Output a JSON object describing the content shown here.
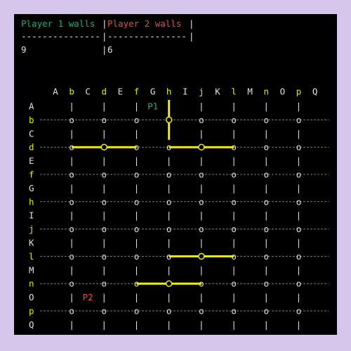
{
  "colors": {
    "background": "#d6c6ec",
    "terminal": "#000000",
    "text": "#e0e0e0",
    "gray_line": "#7a7a7a",
    "player1": "#12b07a",
    "player2": "#e0503c",
    "highlight": "#e8e600",
    "wall": "#f0f000"
  },
  "header": {
    "p1_label": "Player 1 walls",
    "sep1": "|",
    "p2_label": "Player 2 walls",
    "sep2": "|",
    "dashes_left": "---------------",
    "dashes_mid": "|",
    "dashes_right": "---------------",
    "dashes_end": "|",
    "p1_count": "9",
    "count_sep": "|",
    "p2_count": "6"
  },
  "board": {
    "col_labels": [
      "A",
      "b",
      "C",
      "d",
      "E",
      "f",
      "G",
      "h",
      "I",
      "j",
      "K",
      "l",
      "M",
      "n",
      "O",
      "p",
      "Q"
    ],
    "row_labels": [
      "A",
      "b",
      "C",
      "d",
      "E",
      "f",
      "G",
      "h",
      "I",
      "j",
      "K",
      "l",
      "M",
      "n",
      "O",
      "p",
      "Q"
    ],
    "highlight_letters": [
      "b",
      "d",
      "f",
      "h",
      "j",
      "l",
      "n",
      "p"
    ],
    "cell_separator": "|",
    "node_glyph": "o",
    "pawns": [
      {
        "label": "P1",
        "player": 1,
        "row": 0,
        "col": 6
      },
      {
        "label": "P2",
        "player": 2,
        "row": 14,
        "col": 2
      }
    ],
    "walls": [
      {
        "orientation": "vertical",
        "line": 7,
        "from_row": 0,
        "to_row": 2
      },
      {
        "orientation": "horizontal",
        "line": 3,
        "from_col": 1,
        "to_col": 5
      },
      {
        "orientation": "horizontal",
        "line": 3,
        "from_col": 7,
        "to_col": 11
      },
      {
        "orientation": "horizontal",
        "line": 11,
        "from_col": 7,
        "to_col": 11
      },
      {
        "orientation": "horizontal",
        "line": 13,
        "from_col": 5,
        "to_col": 9
      }
    ]
  }
}
